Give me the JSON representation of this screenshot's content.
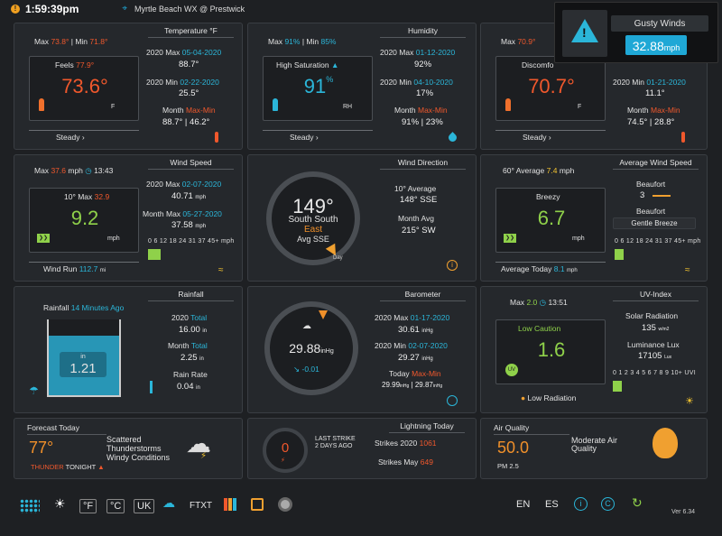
{
  "top": {
    "time": "1:59:39pm",
    "station": "Myrtle Beach WX @ Prestwick"
  },
  "alert": {
    "title": "Gusty Winds",
    "value": "32.88",
    "unit": "mph"
  },
  "temperature": {
    "title": "Temperature °F",
    "max_label": "Max",
    "max": "73.8°",
    "min_label": "Min",
    "min": "71.8°",
    "feels_label": "Feels",
    "feels": "77.9°",
    "value": "73.6°",
    "unit": "°F",
    "trend": "Steady",
    "y_max_label": "2020 Max",
    "y_max_date": "05-04-2020",
    "y_max_val": "88.7°",
    "y_min_label": "2020 Min",
    "y_min_date": "02-22-2020",
    "y_min_val": "25.5°",
    "month_label": "Month",
    "month_maxmin": "Max-Min",
    "month_vals": "88.7° | 46.2°",
    "unit_f": "F"
  },
  "humidity": {
    "title": "Humidity",
    "max": "91%",
    "min": "85%",
    "status": "High Saturation",
    "value": "91",
    "pct": "%",
    "unit": "RH",
    "trend": "Steady",
    "y_max_label": "2020 Max",
    "y_max_date": "01-12-2020",
    "y_max_val": "92%",
    "y_min_label": "2020 Min",
    "y_min_date": "04-10-2020",
    "y_min_val": "17%",
    "month_label": "Month",
    "month_maxmin": "Max-Min",
    "month_vals": "91% | 23%"
  },
  "dewpoint": {
    "max": "70.9°",
    "status": "Discomfo",
    "value": "70.7°",
    "unit": "°F",
    "trend": "Steady",
    "y_min_label": "2020 Min",
    "y_min_date": "01-21-2020",
    "y_min_val": "11.1°",
    "month_label": "Month",
    "month_maxmin": "Max-Min",
    "month_vals": "74.5° | 28.8°"
  },
  "wind": {
    "title": "Wind Speed",
    "max_label": "Max",
    "max": "37.6",
    "unit": "mph",
    "max_time": "13:43",
    "avg_label": "10° Max",
    "avg_val": "32.9",
    "value": "9.2",
    "value_unit": "mph",
    "y_max_label": "2020 Max",
    "y_max_date": "02-07-2020",
    "y_max_val": "40.71",
    "month_label": "Month Max",
    "month_date": "05-27-2020",
    "month_val": "37.58",
    "scale": "0 6 12 18 24 31 37 45+ mph",
    "run_label": "Wind Run",
    "run_val": "112.7",
    "run_unit": "mi",
    "small_unit": "mph"
  },
  "direction": {
    "title": "Wind Direction",
    "deg": "149°",
    "name": "South South",
    "name2": "East",
    "avg": "Avg SSE",
    "avg_label": "10° Average",
    "avg_val": "148°  SSE",
    "month_label": "Month Avg",
    "month_val": "215°  SW",
    "badge": "Day"
  },
  "avgwind": {
    "title": "Average Wind Speed",
    "head": "60° Average",
    "head_val": "7.4",
    "head_unit": "mph",
    "status": "Breezy",
    "value": "6.7",
    "unit": "mph",
    "beaufort_label": "Beaufort",
    "beaufort_val": "3",
    "beaufort_label2": "Beaufort",
    "beaufort_desc": "Gentle Breeze",
    "scale": "0 6 12 18 24 31 37 45+ mph",
    "today_label": "Average Today",
    "today_val": "8.1",
    "today_unit": "mph"
  },
  "rain": {
    "title": "Rainfall",
    "ago_label": "Rainfall",
    "ago_val": "14 Minutes Ago",
    "in": "in",
    "value": "1.21",
    "y_label": "2020",
    "y_total": "Total",
    "y_val": "16.00",
    "y_unit": "in",
    "m_label": "Month",
    "m_total": "Total",
    "m_val": "2.25",
    "m_unit": "in",
    "rate_label": "Rain Rate",
    "rate_val": "0.04",
    "rate_unit": "in"
  },
  "baro": {
    "title": "Barometer",
    "value": "29.88",
    "unit": "inHg",
    "change": "-0.01",
    "y_max_label": "2020 Max",
    "y_max_date": "01-17-2020",
    "y_max_val": "30.61",
    "y_min_label": "2020 Min",
    "y_min_date": "02-07-2020",
    "y_min_val": "29.27",
    "unit_small": "inHg",
    "today_label": "Today",
    "today_maxmin": "Max-Min",
    "today_vals_1": "29.99",
    "today_vals_2": "29.87"
  },
  "uv": {
    "title": "UV-Index",
    "max_label": "Max",
    "max": "2.0",
    "max_time": "13:51",
    "status": "Low Caution",
    "value": "1.6",
    "badge": "UV",
    "rad_status": "Low Radiation",
    "solar_label": "Solar Radiation",
    "solar_val": "135",
    "solar_unit": "w/m2",
    "lux_label": "Luminance Lux",
    "lux_val": "17105",
    "lux_unit": "Lux",
    "scale": "0 1 2 3 4 5 6 7 8 9 10+ UVI"
  },
  "forecast": {
    "title": "Forecast Today",
    "temp": "77°",
    "desc1": "Scattered",
    "desc2": "Thunderstorms",
    "desc3": "Windy Conditions",
    "warn": "THUNDER",
    "warn2": "TONIGHT"
  },
  "lightning": {
    "title": "Lightning Today",
    "count": "0",
    "last_label": "LAST STRIKE",
    "last_val": "2 DAYS AGO",
    "y_label": "Strikes 2020",
    "y_val": "1061",
    "m_label": "Strikes May",
    "m_val": "649"
  },
  "air": {
    "title": "Air Quality",
    "value": "50.0",
    "unit": "PM 2.5",
    "desc1": "Moderate Air",
    "desc2": "Quality"
  },
  "bottom": {
    "f": "°F",
    "c": "°C",
    "uk": "UK",
    "ftxt": "FTXT",
    "en": "EN",
    "es": "ES",
    "version": "Ver 6.34"
  },
  "colors": {
    "accent": "#2bb6d9",
    "red": "#f0582c",
    "orange": "#f0902a",
    "green": "#8fd14a"
  }
}
